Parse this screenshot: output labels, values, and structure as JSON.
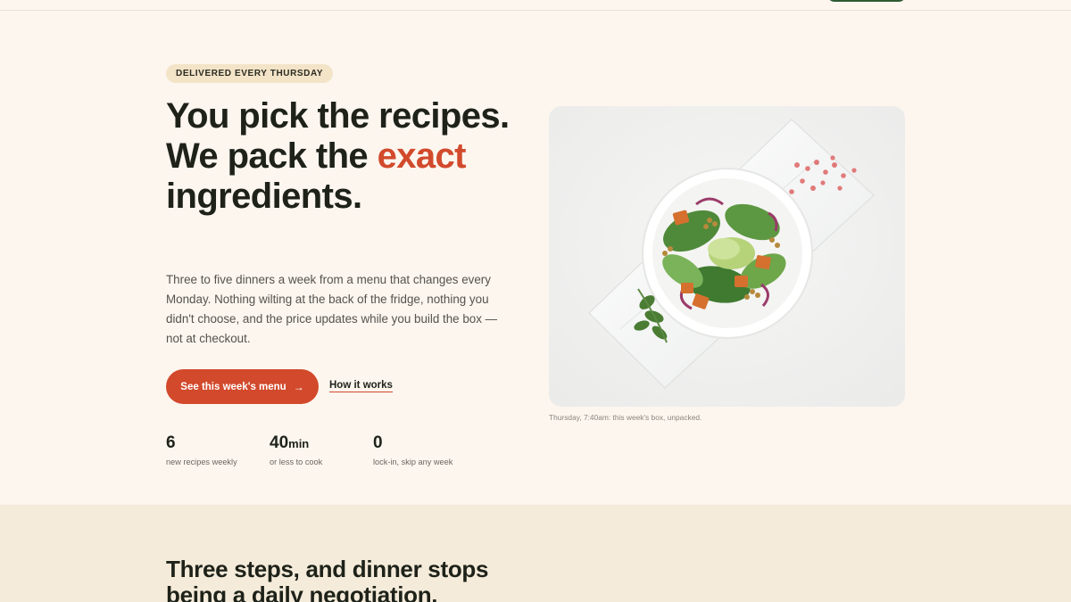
{
  "hero": {
    "eyebrow": "DELIVERED EVERY THURSDAY",
    "headline_line1": "You pick the recipes.",
    "headline_line2_prefix": "We pack the ",
    "headline_accent": "exact",
    "headline_line2_suffix": " ingredients.",
    "lede": "Three to five dinners a week from a menu that changes every Monday. Nothing wilting at the back of the fridge, nothing you didn't choose, and the price updates while you build the box — not at checkout.",
    "cta_primary": "See this week's menu",
    "cta_primary_icon": "arrow-right-icon",
    "cta_secondary": "How it works",
    "stats": [
      {
        "value": "6",
        "unit": "",
        "label": "new recipes weekly"
      },
      {
        "value": "40",
        "unit": "min",
        "label": "or less to cook"
      },
      {
        "value": "0",
        "unit": "",
        "label": "lock-in, skip any week"
      }
    ],
    "photo_caption": "Thursday, 7:40am: this week's box, unpacked."
  },
  "section2": {
    "title": "Three steps, and dinner stops being a daily negotiation."
  },
  "colors": {
    "background": "#fcf6ef",
    "accent": "#d2492b",
    "ink": "#1e2219",
    "eyebrow_bg": "#f3e4c8",
    "section2_bg": "#f5ebda",
    "topbar_button": "#2f5a34"
  }
}
